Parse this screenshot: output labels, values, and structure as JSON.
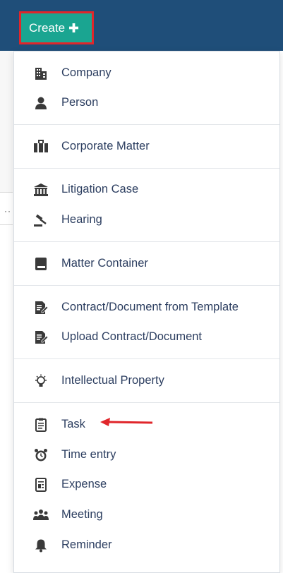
{
  "header": {
    "create_label": "Create"
  },
  "menu": {
    "items": [
      {
        "label": "Company",
        "icon": "building-icon"
      },
      {
        "label": "Person",
        "icon": "person-icon"
      },
      {
        "label": "Corporate Matter",
        "icon": "briefcase-icon"
      },
      {
        "label": "Litigation Case",
        "icon": "courthouse-icon"
      },
      {
        "label": "Hearing",
        "icon": "gavel-icon"
      },
      {
        "label": "Matter Container",
        "icon": "book-icon"
      },
      {
        "label": "Contract/Document from Template",
        "icon": "document-edit-icon"
      },
      {
        "label": "Upload Contract/Document",
        "icon": "document-edit-icon"
      },
      {
        "label": "Intellectual Property",
        "icon": "lightbulb-icon"
      },
      {
        "label": "Task",
        "icon": "clipboard-icon"
      },
      {
        "label": "Time entry",
        "icon": "alarm-clock-icon"
      },
      {
        "label": "Expense",
        "icon": "receipt-icon"
      },
      {
        "label": "Meeting",
        "icon": "group-icon"
      },
      {
        "label": "Reminder",
        "icon": "bell-icon"
      }
    ]
  },
  "colors": {
    "header_bg": "#1f4e79",
    "create_bg": "#1aa591",
    "highlight_border": "#e0262b",
    "label_text": "#2c3e60",
    "icon": "#3a3a3a",
    "arrow": "#e0262b"
  }
}
